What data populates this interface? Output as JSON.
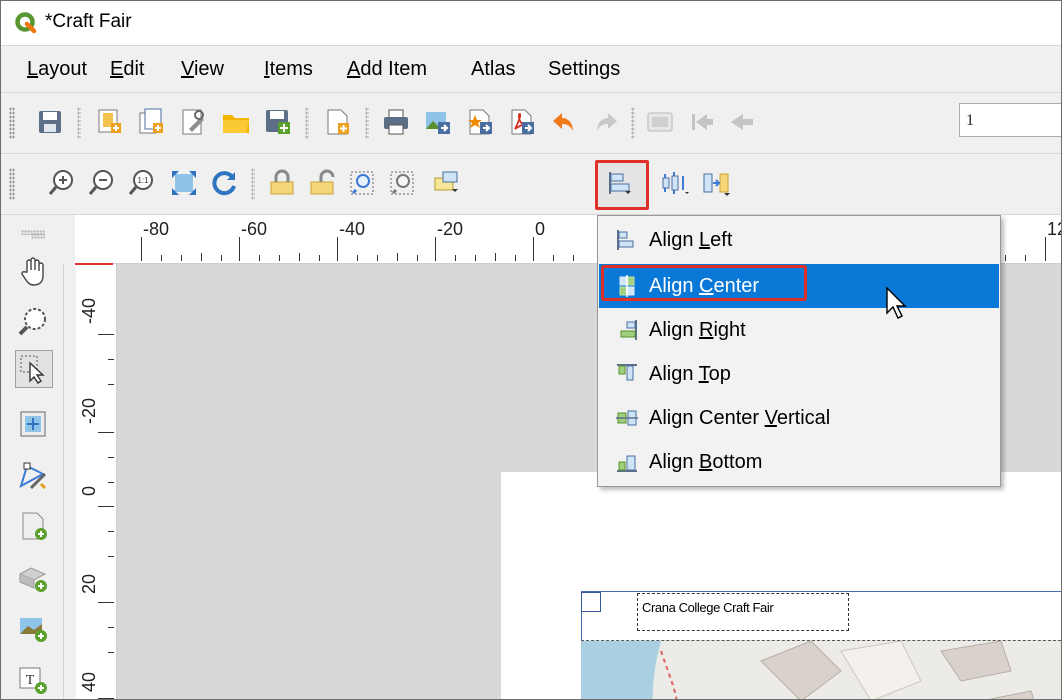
{
  "window": {
    "title": "*Craft Fair"
  },
  "menubar": {
    "items": [
      {
        "label": "Layout",
        "key": "L"
      },
      {
        "label": "Edit",
        "key": "E"
      },
      {
        "label": "View",
        "key": "V"
      },
      {
        "label": "Items",
        "key": "I"
      },
      {
        "label": "Add Item",
        "key": "A"
      },
      {
        "label": "Atlas",
        "key": ""
      },
      {
        "label": "Settings",
        "key": ""
      }
    ]
  },
  "toolbar_top": {
    "page_value": "1"
  },
  "rulers": {
    "horizontal_labels": [
      "-80",
      "-60",
      "-40",
      "-20",
      "0",
      "12"
    ],
    "vertical_labels": [
      "-40",
      "-20",
      "0",
      "20",
      "40"
    ]
  },
  "align_menu": {
    "items": [
      {
        "label": "Align Left",
        "pre": "Align ",
        "key": "L",
        "post": "eft",
        "icon": "align-left-icon"
      },
      {
        "label": "Align Center",
        "pre": "Align ",
        "key": "C",
        "post": "enter",
        "icon": "align-center-icon",
        "active": true
      },
      {
        "label": "Align Right",
        "pre": "Align ",
        "key": "R",
        "post": "ight",
        "icon": "align-right-icon"
      },
      {
        "label": "Align Top",
        "pre": "Align ",
        "key": "T",
        "post": "op",
        "icon": "align-top-icon"
      },
      {
        "label": "Align Center Vertical",
        "pre": "Align Center ",
        "key": "V",
        "post": "ertical",
        "icon": "align-center-vertical-icon"
      },
      {
        "label": "Align Bottom",
        "pre": "Align ",
        "key": "B",
        "post": "ottom",
        "icon": "align-bottom-icon"
      }
    ]
  },
  "layout": {
    "label_text": "Crana College Craft Fair"
  },
  "colors": {
    "highlight": "#e0302a",
    "menu_active": "#0a78d7"
  }
}
